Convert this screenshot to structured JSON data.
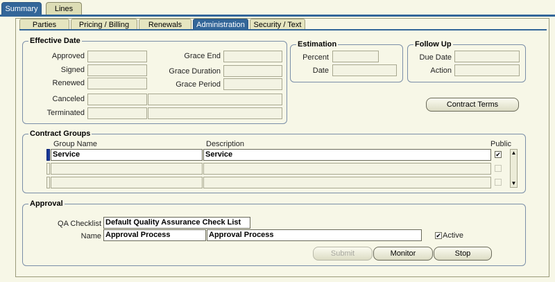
{
  "top_tabs": [
    {
      "label": "Summary",
      "active": true
    },
    {
      "label": "Lines",
      "active": false
    }
  ],
  "sub_tabs": [
    {
      "label": "Parties",
      "active": false
    },
    {
      "label": "Pricing / Billing",
      "active": false
    },
    {
      "label": "Renewals",
      "active": false
    },
    {
      "label": "Administration",
      "active": true
    },
    {
      "label": "Security / Text",
      "active": false
    }
  ],
  "effective_date": {
    "legend": "Effective Date",
    "approved_label": "Approved",
    "approved_value": "",
    "signed_label": "Signed",
    "signed_value": "",
    "renewed_label": "Renewed",
    "renewed_value": "",
    "canceled_label": "Canceled",
    "canceled_value": "",
    "terminated_label": "Terminated",
    "terminated_value": "",
    "grace_end_label": "Grace End",
    "grace_end_value": "",
    "grace_duration_label": "Grace Duration",
    "grace_duration_value": "",
    "grace_period_label": "Grace Period",
    "grace_period_value": ""
  },
  "estimation": {
    "legend": "Estimation",
    "percent_label": "Percent",
    "percent_value": "",
    "date_label": "Date",
    "date_value": ""
  },
  "follow_up": {
    "legend": "Follow Up",
    "due_date_label": "Due Date",
    "due_date_value": "",
    "action_label": "Action",
    "action_value": ""
  },
  "contract_terms_button": "Contract Terms",
  "contract_groups": {
    "legend": "Contract Groups",
    "col_group_name": "Group Name",
    "col_description": "Description",
    "col_public": "Public",
    "rows": [
      {
        "group_name": "Service",
        "description": "Service",
        "public": true
      },
      {
        "group_name": "",
        "description": "",
        "public": false
      },
      {
        "group_name": "",
        "description": "",
        "public": false
      }
    ]
  },
  "approval": {
    "legend": "Approval",
    "qa_checklist_label": "QA Checklist",
    "qa_checklist_value": "Default Quality Assurance Check List",
    "name_label": "Name",
    "name_value": "Approval Process",
    "name_description": "Approval Process",
    "active_label": "Active",
    "active": true,
    "submit_label": "Submit",
    "monitor_label": "Monitor",
    "stop_label": "Stop"
  },
  "colors": {
    "accent": "#336699",
    "background": "#f7f7e7",
    "current_row": "#1a3a9a"
  }
}
